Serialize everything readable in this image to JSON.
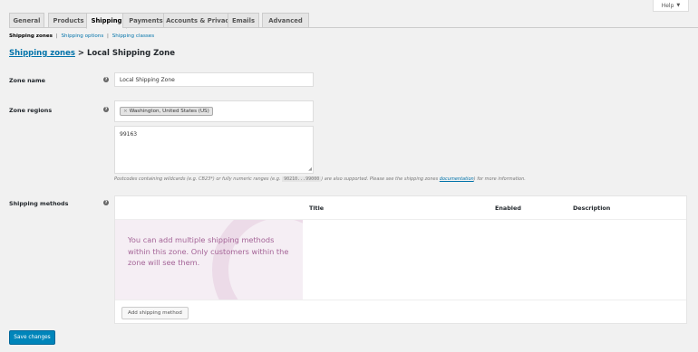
{
  "help": {
    "label": "Help",
    "caret": "▼"
  },
  "tabs": [
    {
      "label": "General"
    },
    {
      "label": "Products"
    },
    {
      "label": "Shipping"
    },
    {
      "label": "Payments"
    },
    {
      "label": "Accounts & Privacy"
    },
    {
      "label": "Emails"
    },
    {
      "label": "Advanced"
    }
  ],
  "subnav": {
    "current": "Shipping zones",
    "sep": "|",
    "options": "Shipping options",
    "classes": "Shipping classes"
  },
  "heading": {
    "link": "Shipping zones",
    "rest": " > Local Shipping Zone"
  },
  "zone_name": {
    "label": "Zone name",
    "value": "Local Shipping Zone"
  },
  "zone_regions": {
    "label": "Zone regions",
    "tag_x": "×",
    "tag": "Washington, United States (US)",
    "postcodes": "99163"
  },
  "hint": {
    "before": "Postcodes containing wildcards (e.g. CB23*) or fully numeric ranges (e.g. ",
    "code": "90210...99000",
    "middle": ") are also supported. Please see the shipping zones ",
    "link": "documentation",
    "after": ") for more information."
  },
  "methods": {
    "label": "Shipping methods",
    "col_title": "Title",
    "col_enabled": "Enabled",
    "col_description": "Description",
    "blank_text": "You can add multiple shipping methods within this zone. Only customers within the zone will see them.",
    "add_button": "Add shipping method"
  },
  "save_button": "Save changes",
  "help_icon": "?"
}
